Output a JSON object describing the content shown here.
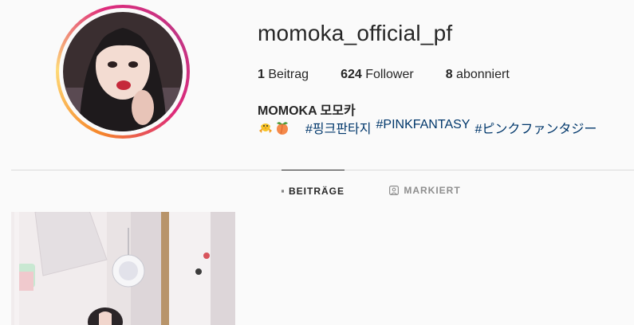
{
  "profile": {
    "username": "momoka_official_pf",
    "stats": {
      "posts_count": "1",
      "posts_label": "Beitrag",
      "followers_count": "624",
      "followers_label": "Follower",
      "following_count": "8",
      "following_label": "abonniert"
    },
    "full_name": "MOMOKA 모모카",
    "bio": {
      "emojis": [
        "chick-emoji",
        "peach-emoji"
      ],
      "hashtags": [
        "#핑크판타지",
        "#PINKFANTASY",
        "#ピンクファンタジー"
      ]
    }
  },
  "tabs": {
    "posts": {
      "label": "BEITRÄGE",
      "icon": "grid-icon"
    },
    "tagged": {
      "label": "MARKIERT",
      "icon": "tagged-user-icon"
    }
  },
  "colors": {
    "background": "#fafafa",
    "text": "#262626",
    "hashtag": "#00376b",
    "muted": "#8e8e8e",
    "divider": "#dbdbdb",
    "story_ring": [
      "#f58529",
      "#dd2a7b",
      "#c13584"
    ]
  }
}
